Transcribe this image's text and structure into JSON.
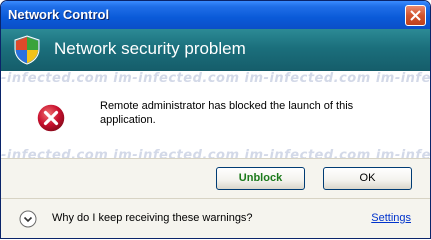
{
  "window": {
    "title": "Network Control"
  },
  "header": {
    "title": "Network security problem"
  },
  "message": {
    "text": "Remote administrator has blocked the launch of this application."
  },
  "watermark": {
    "text": "-infected.com  im-infected.com  im-infected.com  im-infected.com  im-infected.com"
  },
  "buttons": {
    "unblock_label": "Unblock",
    "ok_label": "OK"
  },
  "footer": {
    "question": "Why do I keep receiving these warnings?",
    "settings_label": "Settings"
  },
  "icons": [
    "close-icon",
    "shield-icon",
    "error-icon",
    "chevron-down-icon"
  ],
  "colors": {
    "titlebar": "#0a5ad8",
    "header": "#1b6f7c",
    "unblock_text": "#1c7a1c",
    "link": "#0033cc",
    "error_red": "#c8102e"
  }
}
